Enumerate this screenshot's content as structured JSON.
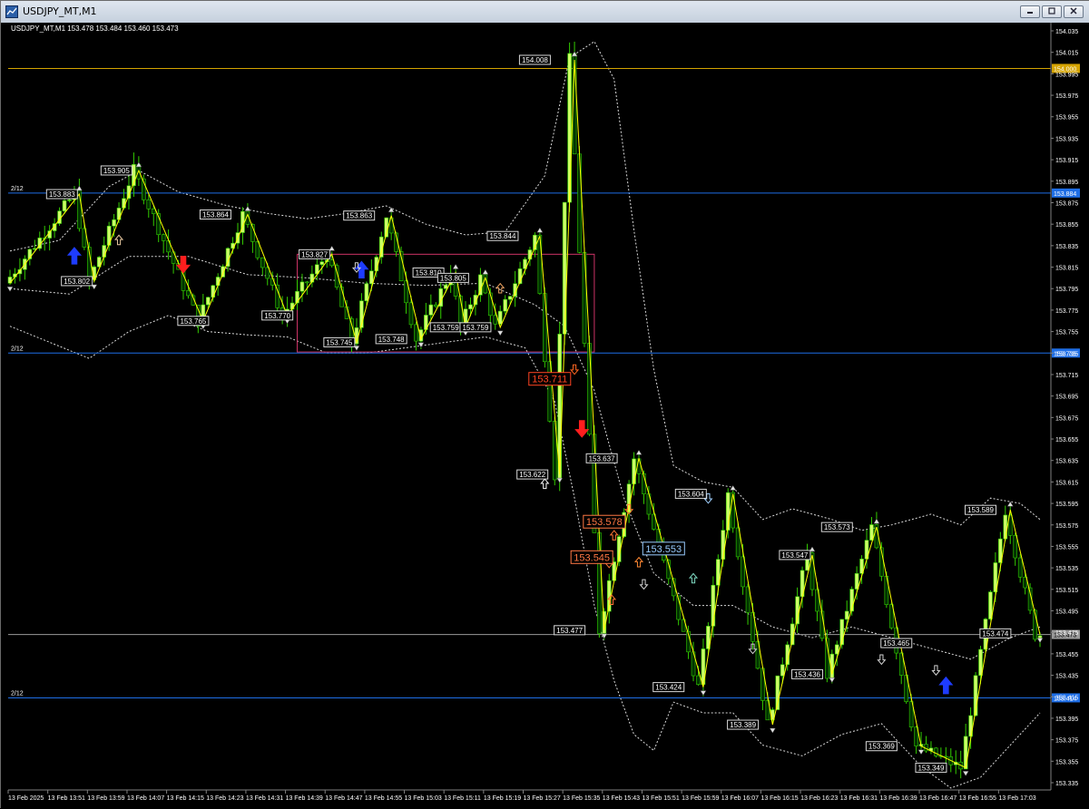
{
  "window": {
    "title": "USDJPY_MT,M1",
    "minimize_icon": "minimize-icon",
    "restore_icon": "restore-icon",
    "close_icon": "close-icon"
  },
  "chart_header": {
    "text": "USDJPY_MT,M1  153.478 153.484 153.460 153.473"
  },
  "colors": {
    "background": "#000000",
    "candle_up_body": "#ccff66",
    "candle_down_body": "#003300",
    "candle_wick": "#33cc00",
    "zigzag": "#ffff00",
    "bands": "#ffffff",
    "line_gold": "#d4a300",
    "line_blue": "#1e6ee6",
    "line_gray": "#9a9a9a",
    "box": "#cc3366",
    "arrow_up_blue": "#1e3cff",
    "arrow_down_red": "#ff1e1e"
  },
  "chart_data": {
    "type": "candlestick",
    "symbol": "USDJPY_MT",
    "timeframe": "M1",
    "ohlc_current": {
      "open": 153.478,
      "high": 153.484,
      "low": 153.46,
      "close": 153.473
    },
    "y_range": [
      153.33,
      154.045
    ],
    "y_ticks": [
      "154.035",
      "154.015",
      "153.995",
      "153.975",
      "153.955",
      "153.935",
      "153.915",
      "153.895",
      "153.875",
      "153.855",
      "153.835",
      "153.815",
      "153.795",
      "153.775",
      "153.755",
      "153.735",
      "153.715",
      "153.695",
      "153.675",
      "153.655",
      "153.635",
      "153.615",
      "153.595",
      "153.575",
      "153.555",
      "153.535",
      "153.515",
      "153.495",
      "153.475",
      "153.455",
      "153.435",
      "153.415",
      "153.395",
      "153.375",
      "153.355",
      "153.335"
    ],
    "x_range_minutes": [
      0,
      212
    ],
    "x_ticks": [
      {
        "label": "13 Feb 2025",
        "t": 0
      },
      {
        "label": "13 Feb 13:51",
        "t": 8
      },
      {
        "label": "13 Feb 13:59",
        "t": 16
      },
      {
        "label": "13 Feb 14:07",
        "t": 24
      },
      {
        "label": "13 Feb 14:15",
        "t": 32
      },
      {
        "label": "13 Feb 14:23",
        "t": 40
      },
      {
        "label": "13 Feb 14:31",
        "t": 48
      },
      {
        "label": "13 Feb 14:39",
        "t": 56
      },
      {
        "label": "13 Feb 14:47",
        "t": 64
      },
      {
        "label": "13 Feb 14:55",
        "t": 72
      },
      {
        "label": "13 Feb 15:03",
        "t": 80
      },
      {
        "label": "13 Feb 15:11",
        "t": 88
      },
      {
        "label": "13 Feb 15:19",
        "t": 96
      },
      {
        "label": "13 Feb 15:27",
        "t": 104
      },
      {
        "label": "13 Feb 15:35",
        "t": 112
      },
      {
        "label": "13 Feb 15:43",
        "t": 120
      },
      {
        "label": "13 Feb 15:51",
        "t": 128
      },
      {
        "label": "13 Feb 15:59",
        "t": 136
      },
      {
        "label": "13 Feb 16:07",
        "t": 144
      },
      {
        "label": "13 Feb 16:15",
        "t": 152
      },
      {
        "label": "13 Feb 16:23",
        "t": 160
      },
      {
        "label": "13 Feb 16:31",
        "t": 168
      },
      {
        "label": "13 Feb 16:39",
        "t": 176
      },
      {
        "label": "13 Feb 16:47",
        "t": 184
      },
      {
        "label": "13 Feb 16:55",
        "t": 192
      },
      {
        "label": "13 Feb 17:03",
        "t": 200
      }
    ],
    "horizontal_lines": [
      {
        "price": 154.0,
        "label": "154.000",
        "color": "#d4a300",
        "left_text": ""
      },
      {
        "price": 153.884,
        "label": "153.884",
        "color": "#1e6ee6",
        "left_text": "2/12"
      },
      {
        "price": 153.735,
        "label": "153.735",
        "color": "#1e6ee6",
        "left_text": "2/12"
      },
      {
        "price": 153.473,
        "label": "153.473",
        "color": "#9a9a9a",
        "left_text": ""
      },
      {
        "price": 153.414,
        "label": "153.414",
        "color": "#1e6ee6",
        "left_text": "2/12"
      }
    ],
    "zigzag": [
      {
        "t": 0,
        "p": 153.8
      },
      {
        "t": 14,
        "p": 153.883
      },
      {
        "t": 17,
        "p": 153.802
      },
      {
        "t": 26,
        "p": 153.905
      },
      {
        "t": 39,
        "p": 153.765
      },
      {
        "t": 48,
        "p": 153.864
      },
      {
        "t": 56,
        "p": 153.77
      },
      {
        "t": 65,
        "p": 153.827
      },
      {
        "t": 70,
        "p": 153.745
      },
      {
        "t": 77,
        "p": 153.863
      },
      {
        "t": 83,
        "p": 153.748
      },
      {
        "t": 90,
        "p": 153.81
      },
      {
        "t": 92,
        "p": 153.759
      },
      {
        "t": 96,
        "p": 153.805
      },
      {
        "t": 99,
        "p": 153.759
      },
      {
        "t": 107,
        "p": 153.844
      },
      {
        "t": 111,
        "p": 153.622
      },
      {
        "t": 114,
        "p": 154.008
      },
      {
        "t": 120,
        "p": 153.477
      },
      {
        "t": 127,
        "p": 153.637
      },
      {
        "t": 140,
        "p": 153.424
      },
      {
        "t": 146,
        "p": 153.604
      },
      {
        "t": 154,
        "p": 153.389
      },
      {
        "t": 162,
        "p": 153.547
      },
      {
        "t": 166,
        "p": 153.436
      },
      {
        "t": 175,
        "p": 153.573
      },
      {
        "t": 184,
        "p": 153.369
      },
      {
        "t": 193,
        "p": 153.349
      },
      {
        "t": 202,
        "p": 153.589
      },
      {
        "t": 208,
        "p": 153.473
      }
    ],
    "swing_labels": [
      {
        "t": 10.5,
        "p": 153.883,
        "text": "153.883"
      },
      {
        "t": 21.5,
        "p": 153.905,
        "text": "153.905"
      },
      {
        "t": 13.5,
        "p": 153.802,
        "text": "153.802"
      },
      {
        "t": 37,
        "p": 153.765,
        "text": "153.765"
      },
      {
        "t": 41.5,
        "p": 153.864,
        "text": "153.864"
      },
      {
        "t": 54,
        "p": 153.77,
        "text": "153.770"
      },
      {
        "t": 61.5,
        "p": 153.827,
        "text": "153.827"
      },
      {
        "t": 66.5,
        "p": 153.745,
        "text": "153.745"
      },
      {
        "t": 70.5,
        "p": 153.863,
        "text": "153.863"
      },
      {
        "t": 77,
        "p": 153.748,
        "text": "153.748"
      },
      {
        "t": 84.5,
        "p": 153.81,
        "text": "153.810"
      },
      {
        "t": 88,
        "p": 153.759,
        "text": "153.759"
      },
      {
        "t": 89.5,
        "p": 153.805,
        "text": "153.805"
      },
      {
        "t": 94,
        "p": 153.759,
        "text": "153.759"
      },
      {
        "t": 99.5,
        "p": 153.844,
        "text": "153.844"
      },
      {
        "t": 105.5,
        "p": 153.622,
        "text": "153.622"
      },
      {
        "t": 106,
        "p": 154.008,
        "text": "154.008"
      },
      {
        "t": 113,
        "p": 153.477,
        "text": "153.477"
      },
      {
        "t": 119.5,
        "p": 153.637,
        "text": "153.637"
      },
      {
        "t": 133,
        "p": 153.424,
        "text": "153.424"
      },
      {
        "t": 137.5,
        "p": 153.604,
        "text": "153.604"
      },
      {
        "t": 148,
        "p": 153.389,
        "text": "153.389"
      },
      {
        "t": 158.5,
        "p": 153.547,
        "text": "153.547"
      },
      {
        "t": 161,
        "p": 153.436,
        "text": "153.436"
      },
      {
        "t": 167,
        "p": 153.573,
        "text": "153.573"
      },
      {
        "t": 179,
        "p": 153.465,
        "text": "153.465"
      },
      {
        "t": 176,
        "p": 153.369,
        "text": "153.369"
      },
      {
        "t": 186,
        "p": 153.349,
        "text": "153.349"
      },
      {
        "t": 196,
        "p": 153.589,
        "text": "153.589"
      },
      {
        "t": 199,
        "p": 153.474,
        "text": "153.474"
      }
    ],
    "big_labels": [
      {
        "t": 109,
        "p": 153.711,
        "text": "153.711",
        "color": "#ff4422"
      },
      {
        "t": 120,
        "p": 153.578,
        "text": "153.578",
        "color": "#ff7744"
      },
      {
        "t": 117.5,
        "p": 153.545,
        "text": "153.545",
        "color": "#ff7744"
      },
      {
        "t": 132,
        "p": 153.553,
        "text": "153.553",
        "color": "#99ccff"
      }
    ],
    "box": {
      "t1": 58,
      "t2": 118,
      "p1": 153.827,
      "p2": 153.736
    },
    "bands_upper": [
      {
        "t": 0,
        "p": 153.83
      },
      {
        "t": 10,
        "p": 153.84
      },
      {
        "t": 20,
        "p": 153.89
      },
      {
        "t": 26,
        "p": 153.905
      },
      {
        "t": 34,
        "p": 153.885
      },
      {
        "t": 44,
        "p": 153.872
      },
      {
        "t": 52,
        "p": 153.865
      },
      {
        "t": 60,
        "p": 153.86
      },
      {
        "t": 68,
        "p": 153.865
      },
      {
        "t": 76,
        "p": 153.872
      },
      {
        "t": 84,
        "p": 153.855
      },
      {
        "t": 92,
        "p": 153.845
      },
      {
        "t": 100,
        "p": 153.848
      },
      {
        "t": 108,
        "p": 153.9
      },
      {
        "t": 113,
        "p": 154.01
      },
      {
        "t": 118,
        "p": 154.025
      },
      {
        "t": 122,
        "p": 153.99
      },
      {
        "t": 126,
        "p": 153.85
      },
      {
        "t": 130,
        "p": 153.72
      },
      {
        "t": 134,
        "p": 153.63
      },
      {
        "t": 140,
        "p": 153.615
      },
      {
        "t": 146,
        "p": 153.61
      },
      {
        "t": 152,
        "p": 153.58
      },
      {
        "t": 158,
        "p": 153.59
      },
      {
        "t": 166,
        "p": 153.58
      },
      {
        "t": 172,
        "p": 153.57
      },
      {
        "t": 178,
        "p": 153.575
      },
      {
        "t": 186,
        "p": 153.585
      },
      {
        "t": 192,
        "p": 153.575
      },
      {
        "t": 198,
        "p": 153.6
      },
      {
        "t": 204,
        "p": 153.595
      },
      {
        "t": 208,
        "p": 153.58
      }
    ],
    "bands_lower": [
      {
        "t": 0,
        "p": 153.76
      },
      {
        "t": 8,
        "p": 153.745
      },
      {
        "t": 16,
        "p": 153.73
      },
      {
        "t": 24,
        "p": 153.755
      },
      {
        "t": 32,
        "p": 153.77
      },
      {
        "t": 40,
        "p": 153.755
      },
      {
        "t": 48,
        "p": 153.752
      },
      {
        "t": 56,
        "p": 153.75
      },
      {
        "t": 64,
        "p": 153.735
      },
      {
        "t": 72,
        "p": 153.735
      },
      {
        "t": 80,
        "p": 153.74
      },
      {
        "t": 88,
        "p": 153.745
      },
      {
        "t": 96,
        "p": 153.75
      },
      {
        "t": 104,
        "p": 153.74
      },
      {
        "t": 110,
        "p": 153.69
      },
      {
        "t": 114,
        "p": 153.6
      },
      {
        "t": 118,
        "p": 153.5
      },
      {
        "t": 122,
        "p": 153.43
      },
      {
        "t": 126,
        "p": 153.38
      },
      {
        "t": 130,
        "p": 153.365
      },
      {
        "t": 134,
        "p": 153.41
      },
      {
        "t": 140,
        "p": 153.4
      },
      {
        "t": 146,
        "p": 153.4
      },
      {
        "t": 152,
        "p": 153.37
      },
      {
        "t": 160,
        "p": 153.36
      },
      {
        "t": 168,
        "p": 153.38
      },
      {
        "t": 176,
        "p": 153.39
      },
      {
        "t": 184,
        "p": 153.35
      },
      {
        "t": 190,
        "p": 153.33
      },
      {
        "t": 196,
        "p": 153.34
      },
      {
        "t": 202,
        "p": 153.37
      },
      {
        "t": 208,
        "p": 153.4
      }
    ],
    "bands_middle": [
      {
        "t": 0,
        "p": 153.795
      },
      {
        "t": 12,
        "p": 153.79
      },
      {
        "t": 24,
        "p": 153.825
      },
      {
        "t": 36,
        "p": 153.825
      },
      {
        "t": 48,
        "p": 153.808
      },
      {
        "t": 60,
        "p": 153.805
      },
      {
        "t": 72,
        "p": 153.8
      },
      {
        "t": 84,
        "p": 153.798
      },
      {
        "t": 96,
        "p": 153.8
      },
      {
        "t": 106,
        "p": 153.78
      },
      {
        "t": 112,
        "p": 153.76
      },
      {
        "t": 118,
        "p": 153.7
      },
      {
        "t": 124,
        "p": 153.6
      },
      {
        "t": 130,
        "p": 153.53
      },
      {
        "t": 138,
        "p": 153.5
      },
      {
        "t": 146,
        "p": 153.5
      },
      {
        "t": 154,
        "p": 153.48
      },
      {
        "t": 162,
        "p": 153.47
      },
      {
        "t": 170,
        "p": 153.48
      },
      {
        "t": 178,
        "p": 153.47
      },
      {
        "t": 186,
        "p": 153.46
      },
      {
        "t": 194,
        "p": 153.45
      },
      {
        "t": 202,
        "p": 153.47
      },
      {
        "t": 208,
        "p": 153.48
      }
    ],
    "signal_arrows": [
      {
        "t": 13,
        "p": 153.825,
        "dir": "up",
        "color": "#1e3cff",
        "size": "big"
      },
      {
        "t": 35,
        "p": 153.818,
        "dir": "down",
        "color": "#ff1e1e",
        "size": "big"
      },
      {
        "t": 71,
        "p": 153.812,
        "dir": "up",
        "color": "#1e3cff",
        "size": "big"
      },
      {
        "t": 115.5,
        "p": 153.665,
        "dir": "down",
        "color": "#ff1e1e",
        "size": "big"
      },
      {
        "t": 189,
        "p": 153.425,
        "dir": "up",
        "color": "#1e3cff",
        "size": "big"
      },
      {
        "t": 22,
        "p": 153.84,
        "dir": "up",
        "color": "#e8c8a0",
        "size": "small"
      },
      {
        "t": 70,
        "p": 153.815,
        "dir": "down",
        "color": "#d0d0d0",
        "size": "small"
      },
      {
        "t": 99,
        "p": 153.795,
        "dir": "up",
        "color": "#e8a060",
        "size": "small"
      },
      {
        "t": 108,
        "p": 153.613,
        "dir": "up",
        "color": "#ffffff",
        "size": "small"
      },
      {
        "t": 114,
        "p": 153.72,
        "dir": "down",
        "color": "#ff6622",
        "size": "small"
      },
      {
        "t": 122,
        "p": 153.565,
        "dir": "up",
        "color": "#ff7733",
        "size": "small"
      },
      {
        "t": 125,
        "p": 153.59,
        "dir": "down",
        "color": "#ff7733",
        "size": "small"
      },
      {
        "t": 121,
        "p": 153.54,
        "dir": "down",
        "color": "#ff7733",
        "size": "small"
      },
      {
        "t": 121.5,
        "p": 153.505,
        "dir": "up",
        "color": "#ff7733",
        "size": "small"
      },
      {
        "t": 127,
        "p": 153.54,
        "dir": "up",
        "color": "#ff8833",
        "size": "small"
      },
      {
        "t": 128,
        "p": 153.52,
        "dir": "down",
        "color": "#d0d0d0",
        "size": "small"
      },
      {
        "t": 138,
        "p": 153.525,
        "dir": "up",
        "color": "#7fd9c2",
        "size": "small"
      },
      {
        "t": 141,
        "p": 153.6,
        "dir": "down",
        "color": "#a0d0ff",
        "size": "small"
      },
      {
        "t": 150,
        "p": 153.46,
        "dir": "down",
        "color": "#d0d0d0",
        "size": "small"
      },
      {
        "t": 187,
        "p": 153.44,
        "dir": "down",
        "color": "#d0d0d0",
        "size": "small"
      },
      {
        "t": 176,
        "p": 153.45,
        "dir": "down",
        "color": "#d0d0d0",
        "size": "small"
      }
    ]
  }
}
